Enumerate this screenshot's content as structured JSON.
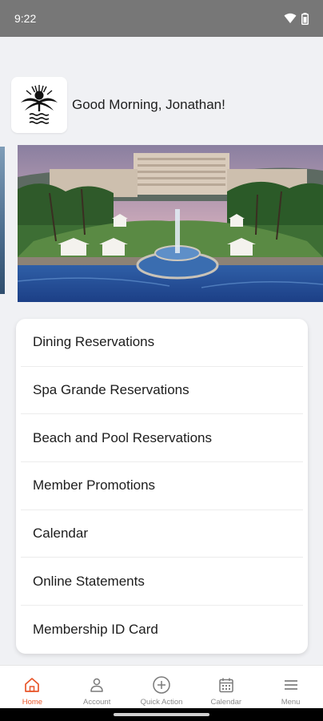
{
  "status_bar": {
    "time": "9:22"
  },
  "header": {
    "greeting": "Good Morning, Jonathan!"
  },
  "menu": {
    "items": [
      {
        "label": "Dining Reservations"
      },
      {
        "label": "Spa Grande Reservations"
      },
      {
        "label": "Beach and Pool Reservations"
      },
      {
        "label": "Member Promotions"
      },
      {
        "label": "Calendar"
      },
      {
        "label": "Online Statements"
      },
      {
        "label": "Membership ID Card"
      }
    ]
  },
  "bottom_nav": {
    "items": [
      {
        "label": "Home",
        "icon": "home-icon",
        "active": true
      },
      {
        "label": "Account",
        "icon": "person-icon",
        "active": false
      },
      {
        "label": "Quick Action",
        "icon": "plus-circle-icon",
        "active": false
      },
      {
        "label": "Calendar",
        "icon": "calendar-icon",
        "active": false
      },
      {
        "label": "Menu",
        "icon": "hamburger-icon",
        "active": false
      }
    ]
  },
  "colors": {
    "accent": "#e8562a",
    "status_bar": "#777777",
    "background": "#f0f1f4"
  }
}
